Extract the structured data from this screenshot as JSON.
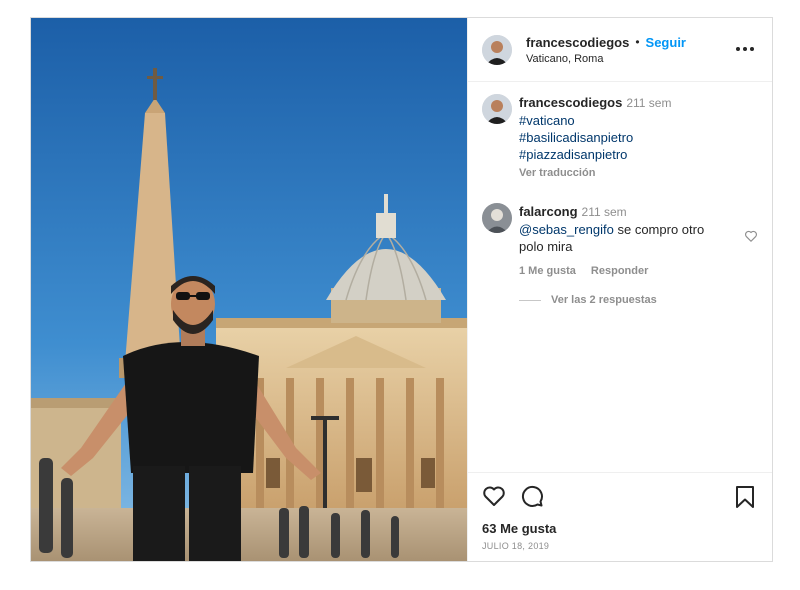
{
  "post": {
    "username": "francescodiegos",
    "separator": "•",
    "follow_label": "Seguir",
    "location": "Vaticano, Roma"
  },
  "caption": {
    "username": "francescodiegos",
    "time": "211 sem",
    "hashtags": [
      "#vaticano",
      "#basilicadisanpietro",
      "#piazzadisanpietro"
    ],
    "translate_label": "Ver traducción"
  },
  "comment": {
    "username": "falarcong",
    "time": "211 sem",
    "mention": "@sebas_rengifo",
    "text": " se compro otro polo mira",
    "likes_label": "1 Me gusta",
    "reply_label": "Responder",
    "view_replies_label": "Ver las 2 respuestas"
  },
  "footer": {
    "likes": "63 Me gusta",
    "date": "JULIO 18, 2019"
  },
  "icons": {
    "more": "more-options-icon",
    "like": "heart-icon",
    "comment": "comment-icon",
    "save": "bookmark-icon",
    "comment_like": "heart-icon"
  },
  "colors": {
    "link_blue": "#0095f6",
    "hashtag": "#00376b",
    "muted": "#8e8e8e",
    "text": "#262626",
    "sky": "#1f6fb8"
  }
}
